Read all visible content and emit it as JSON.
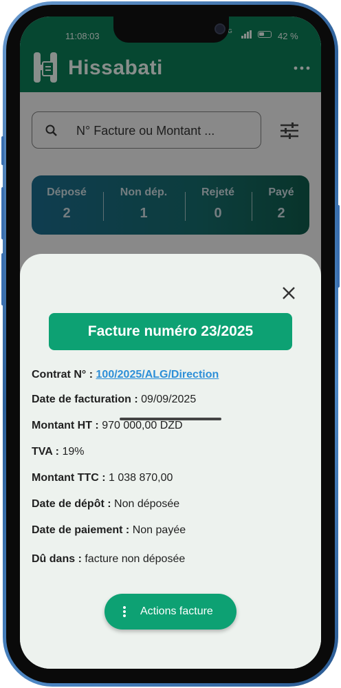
{
  "status_bar": {
    "time": "11:08:03",
    "network": "4G",
    "battery": "42 %"
  },
  "app": {
    "title": "Hissabati"
  },
  "search": {
    "placeholder": "N° Facture ou Montant ..."
  },
  "stats": [
    {
      "label": "Déposé",
      "value": "2"
    },
    {
      "label": "Non dép.",
      "value": "1"
    },
    {
      "label": "Rejeté",
      "value": "0"
    },
    {
      "label": "Payé",
      "value": "2"
    }
  ],
  "sheet": {
    "title": "Facture numéro 23/2025",
    "contract_label": "Contrat N° :",
    "contract_value": "100/2025/ALG/Direction",
    "fields": [
      {
        "label": "Date de facturation :",
        "value": "09/09/2025"
      },
      {
        "label": "Montant HT :",
        "value": "970 000,00 DZD"
      },
      {
        "label": "TVA :",
        "value": "19%"
      },
      {
        "label": "Montant TTC :",
        "value": "1 038 870,00"
      },
      {
        "label": "Date de dépôt :",
        "value": "Non déposée"
      },
      {
        "label": "Date de paiement :",
        "value": "Non payée"
      },
      {
        "label": "Dû dans :",
        "value": "facture non déposée"
      }
    ],
    "actions_label": "Actions facture"
  },
  "colors": {
    "primary": "#0b7a55",
    "accent": "#0da173",
    "link": "#2d8fd8",
    "sheet_bg": "#edf2ee"
  },
  "icons": [
    "search-icon",
    "filter-icon",
    "more-icon",
    "close-icon",
    "more-vertical-icon"
  ]
}
